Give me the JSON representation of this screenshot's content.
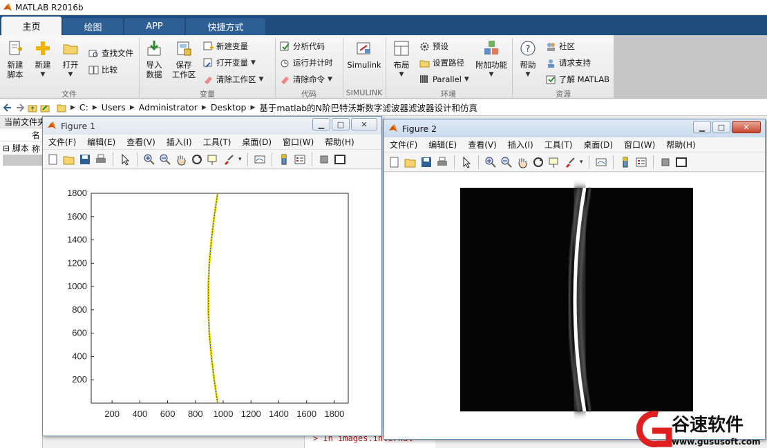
{
  "app": {
    "title": "MATLAB R2016b"
  },
  "tabs": [
    "主页",
    "绘图",
    "APP",
    "快捷方式"
  ],
  "ribbon": {
    "file": {
      "new_script": "新建\n脚本",
      "new": "新建",
      "open": "打开",
      "find_files": "查找文件",
      "compare": "比较",
      "label": "文件"
    },
    "variable": {
      "import": "导入\n数据",
      "save_ws": "保存\n工作区",
      "new_var": "新建变量",
      "open_var": "打开变量",
      "clear_ws": "清除工作区",
      "label": "变量"
    },
    "code": {
      "analyze": "分析代码",
      "run_time": "运行并计时",
      "clear_cmd": "清除命令",
      "label": "代码"
    },
    "simulink": {
      "btn": "Simulink",
      "label": "SIMULINK"
    },
    "env": {
      "layout": "布局",
      "prefs": "预设",
      "set_path": "设置路径",
      "parallel": "Parallel",
      "addons": "附加功能",
      "label": "环境"
    },
    "resources": {
      "help": "帮助",
      "community": "社区",
      "request_support": "请求支持",
      "learn": "了解 MATLAB",
      "label": "资源"
    }
  },
  "address": {
    "crumbs": [
      "C:",
      "Users",
      "Administrator",
      "Desktop",
      "基于matlab的N阶巴特沃斯数字滤波器滤波器设计和仿真"
    ]
  },
  "current_folder": {
    "header": "当前文件夹",
    "col_name": "名称",
    "group": "脚本"
  },
  "editor_snippet": "> In images.internal",
  "figure_menus": [
    "文件(F)",
    "编辑(E)",
    "查看(V)",
    "插入(I)",
    "工具(T)",
    "桌面(D)",
    "窗口(W)",
    "帮助(H)"
  ],
  "figure1": {
    "title": "Figure 1",
    "chart_data": {
      "type": "line",
      "xlabel": "",
      "ylabel": "",
      "xlim": [
        50,
        1900
      ],
      "ylim": [
        0,
        1800
      ],
      "xticks": [
        200,
        400,
        600,
        800,
        1000,
        1200,
        1400,
        1600,
        1800
      ],
      "yticks": [
        200,
        400,
        600,
        800,
        1000,
        1200,
        1400,
        1600,
        1800
      ],
      "series": [
        {
          "color": "#e8d800",
          "x": [
            960,
            935,
            915,
            900,
            893,
            893,
            900,
            915,
            935,
            960
          ],
          "y": [
            0,
            200,
            400,
            600,
            800,
            1000,
            1200,
            1400,
            1600,
            1800
          ]
        }
      ]
    }
  },
  "figure2": {
    "title": "Figure 2"
  },
  "watermark": {
    "brand": "谷速软件",
    "url": "www.gususoft.com"
  }
}
